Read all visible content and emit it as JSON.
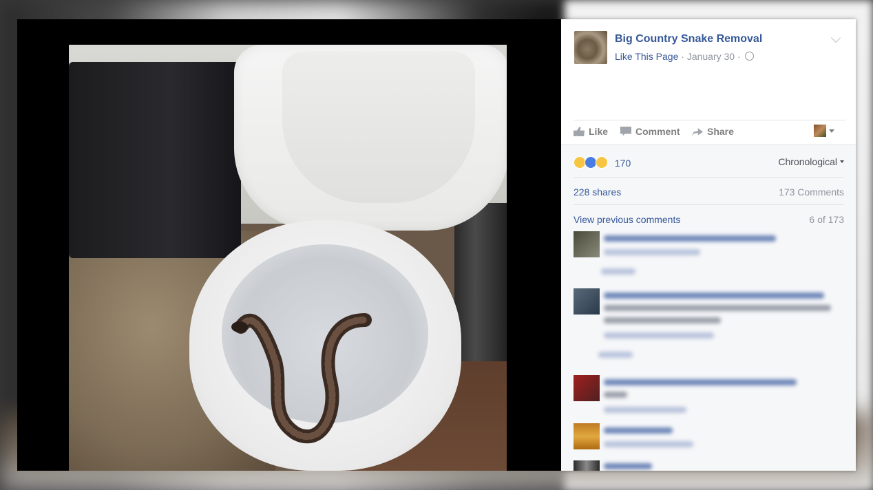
{
  "post": {
    "page_name": "Big Country Snake Removal",
    "like_page": "Like This Page",
    "sep": "·",
    "date": "January 30",
    "actions": {
      "like": "Like",
      "comment": "Comment",
      "share": "Share"
    },
    "reactions": {
      "icons": [
        "wow-icon",
        "thumbs-icon",
        "haha-icon"
      ],
      "count": "170"
    },
    "sort": "Chronological",
    "shares": "228 shares",
    "comments_total": "173 Comments",
    "view_previous": "View previous comments",
    "shown_of": "6 of 173"
  },
  "colors": {
    "link": "#365899",
    "muted": "#90949c",
    "panel_bg": "#f6f7f9"
  }
}
